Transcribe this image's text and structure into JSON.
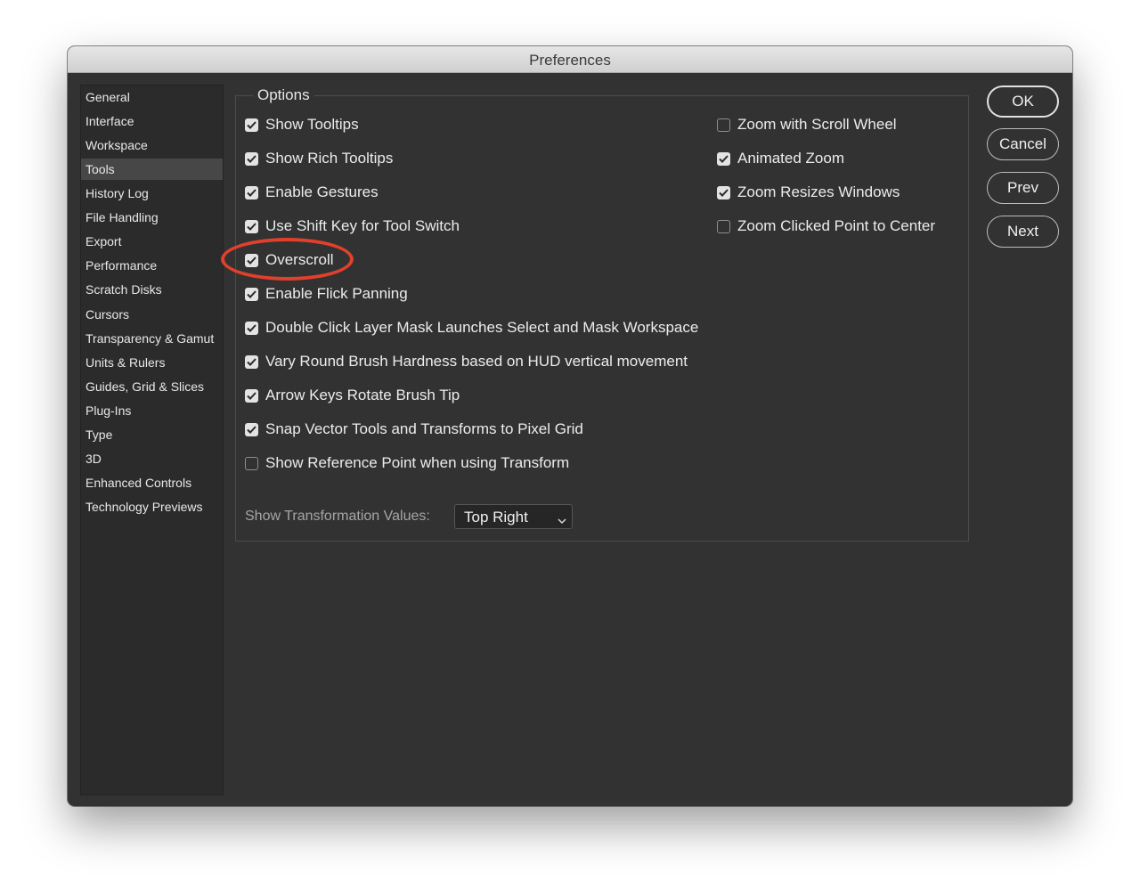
{
  "window": {
    "title": "Preferences"
  },
  "sidebar": {
    "items": [
      {
        "label": "General",
        "selected": false
      },
      {
        "label": "Interface",
        "selected": false
      },
      {
        "label": "Workspace",
        "selected": false
      },
      {
        "label": "Tools",
        "selected": true
      },
      {
        "label": "History Log",
        "selected": false
      },
      {
        "label": "File Handling",
        "selected": false
      },
      {
        "label": "Export",
        "selected": false
      },
      {
        "label": "Performance",
        "selected": false
      },
      {
        "label": "Scratch Disks",
        "selected": false
      },
      {
        "label": "Cursors",
        "selected": false
      },
      {
        "label": "Transparency & Gamut",
        "selected": false
      },
      {
        "label": "Units & Rulers",
        "selected": false
      },
      {
        "label": "Guides, Grid & Slices",
        "selected": false
      },
      {
        "label": "Plug-Ins",
        "selected": false
      },
      {
        "label": "Type",
        "selected": false
      },
      {
        "label": "3D",
        "selected": false
      },
      {
        "label": "Enhanced Controls",
        "selected": false
      },
      {
        "label": "Technology Previews",
        "selected": false
      }
    ]
  },
  "options": {
    "group_label": "Options",
    "left": [
      {
        "label": "Show Tooltips",
        "checked": true
      },
      {
        "label": "Show Rich Tooltips",
        "checked": true
      },
      {
        "label": "Enable Gestures",
        "checked": true
      },
      {
        "label": "Use Shift Key for Tool Switch",
        "checked": true
      },
      {
        "label": "Overscroll",
        "checked": true
      },
      {
        "label": "Enable Flick Panning",
        "checked": true
      },
      {
        "label": "Double Click Layer Mask Launches Select and Mask Workspace",
        "checked": true
      },
      {
        "label": "Vary Round Brush Hardness based on HUD vertical movement",
        "checked": true
      },
      {
        "label": "Arrow Keys Rotate Brush Tip",
        "checked": true
      },
      {
        "label": "Snap Vector Tools and Transforms to Pixel Grid",
        "checked": true
      },
      {
        "label": "Show Reference Point when using Transform",
        "checked": false
      }
    ],
    "right": [
      {
        "label": "Zoom with Scroll Wheel",
        "checked": false
      },
      {
        "label": "Animated Zoom",
        "checked": true
      },
      {
        "label": "Zoom Resizes Windows",
        "checked": true
      },
      {
        "label": "Zoom Clicked Point to Center",
        "checked": false
      }
    ],
    "transformation_values": {
      "label": "Show Transformation Values:",
      "value": "Top Right"
    }
  },
  "buttons": {
    "ok": "OK",
    "cancel": "Cancel",
    "prev": "Prev",
    "next": "Next"
  },
  "annotation": {
    "color": "#e0402c",
    "target": "Overscroll"
  }
}
